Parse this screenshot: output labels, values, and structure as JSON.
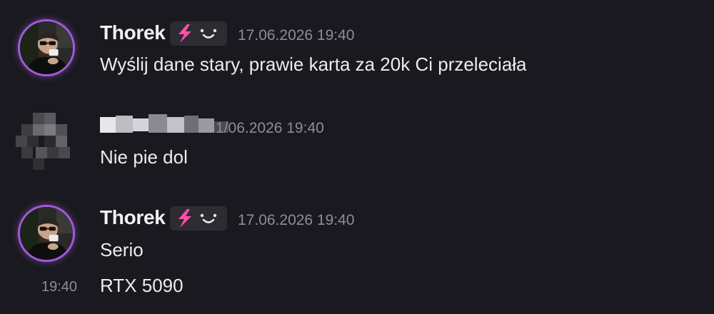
{
  "messages": [
    {
      "author": "Thorek",
      "timestamp": "17.06.2026 19:40",
      "text": "Wyślij dane stary, prawie karta za 20k Ci przeleciała",
      "badge_icon": "lightning-smile-badge"
    },
    {
      "author_hidden": true,
      "timestamp": "1/06.2026 19:40",
      "text": "Nie pie  dol"
    },
    {
      "author": "Thorek",
      "timestamp": "17.06.2026 19:40",
      "text": "Serio",
      "badge_icon": "lightning-smile-badge"
    },
    {
      "hover_time": "19:40",
      "text": "RTX 5090"
    }
  ],
  "colors": {
    "background": "#1a191f",
    "avatar_ring": "#a05bd9",
    "badge_bolt": "#ff4fa8",
    "timestamp": "#8e8d96"
  }
}
